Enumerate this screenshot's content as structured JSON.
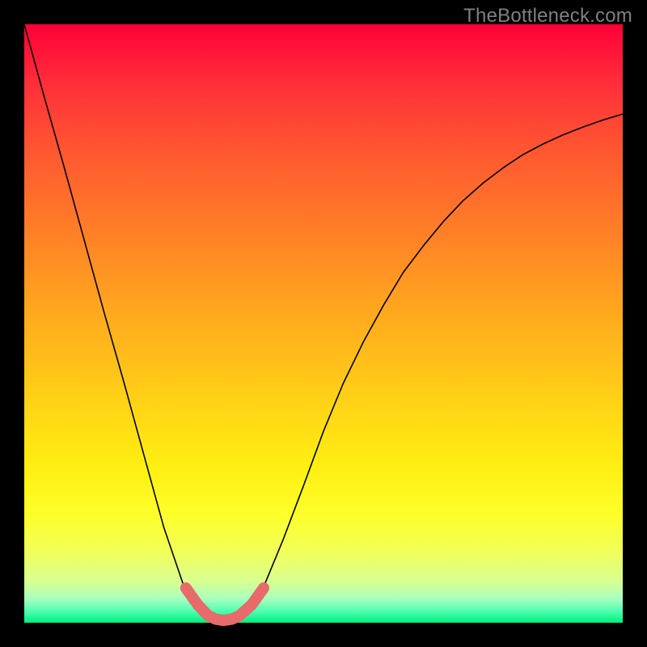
{
  "watermark": "TheBottleneck.com",
  "colors": {
    "frame_bg": "#000000",
    "curve_stroke": "#000000",
    "marker_stroke": "#e86a6a",
    "gradient_top": "#ff0038",
    "gradient_bottom": "#00f07a"
  },
  "chart_data": {
    "type": "line",
    "title": "",
    "xlabel": "",
    "ylabel": "",
    "xlim": [
      0,
      1
    ],
    "ylim": [
      0,
      1
    ],
    "grid": false,
    "legend": false,
    "series": [
      {
        "name": "bottleneck-curve",
        "x": [
          0.0,
          0.033,
          0.067,
          0.1,
          0.133,
          0.167,
          0.2,
          0.233,
          0.267,
          0.293,
          0.307,
          0.32,
          0.333,
          0.347,
          0.36,
          0.373,
          0.4,
          0.433,
          0.467,
          0.5,
          0.533,
          0.567,
          0.6,
          0.633,
          0.667,
          0.7,
          0.733,
          0.767,
          0.8,
          0.833,
          0.867,
          0.9,
          0.933,
          0.967,
          1.0
        ],
        "y": [
          1.0,
          0.88,
          0.76,
          0.64,
          0.52,
          0.4,
          0.28,
          0.16,
          0.06,
          0.02,
          0.01,
          0.005,
          0.003,
          0.005,
          0.01,
          0.02,
          0.06,
          0.14,
          0.23,
          0.32,
          0.4,
          0.47,
          0.53,
          0.585,
          0.63,
          0.67,
          0.705,
          0.735,
          0.76,
          0.782,
          0.8,
          0.815,
          0.828,
          0.84,
          0.85
        ]
      }
    ],
    "marker_band": {
      "name": "optimal-range-marker",
      "x": [
        0.27,
        0.29,
        0.307,
        0.32,
        0.333,
        0.347,
        0.36,
        0.38,
        0.4
      ],
      "y": [
        0.058,
        0.03,
        0.012,
        0.006,
        0.004,
        0.006,
        0.012,
        0.03,
        0.058
      ]
    }
  }
}
